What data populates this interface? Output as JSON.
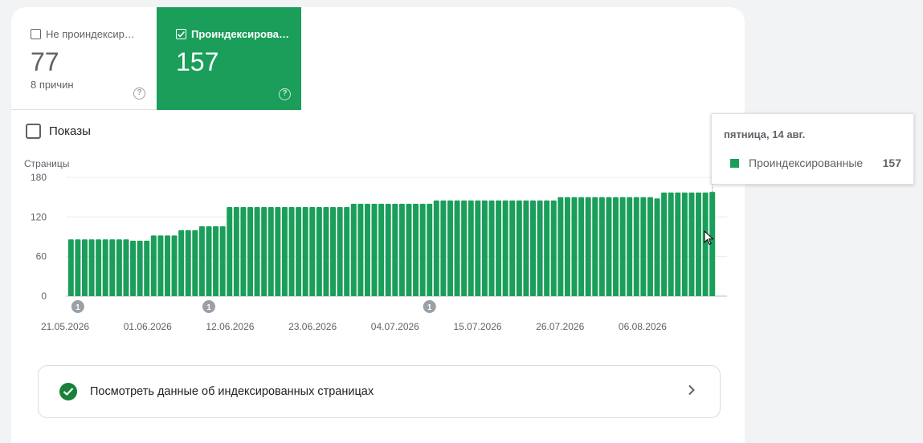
{
  "tabs": {
    "not_indexed": {
      "label": "Не проиндексир…",
      "value": "77",
      "sub": "8 причин"
    },
    "indexed": {
      "label": "Проиндексирова…",
      "value": "157"
    }
  },
  "shows_label": "Показы",
  "colors": {
    "bar": "#1a9e5a",
    "accent": "#188038",
    "grid": "#ececec",
    "axis": "#5f6368"
  },
  "chart_data": {
    "type": "bar",
    "ylabel": "Страницы",
    "ylim": [
      0,
      180
    ],
    "yticks": [
      0,
      60,
      120,
      180
    ],
    "grid": true,
    "xtick_labels": [
      "21.05.2026",
      "01.06.2026",
      "12.06.2026",
      "23.06.2026",
      "04.07.2026",
      "15.07.2026",
      "26.07.2026",
      "06.08.2026"
    ],
    "start_label_index": 0,
    "annotations": [
      {
        "day_index": 1,
        "label": "1"
      },
      {
        "day_index": 20,
        "label": "1"
      },
      {
        "day_index": 52,
        "label": "1"
      }
    ],
    "series": [
      {
        "name": "Проиндексированные",
        "values": [
          86,
          86,
          86,
          86,
          86,
          86,
          86,
          86,
          86,
          84,
          84,
          84,
          92,
          92,
          92,
          92,
          100,
          100,
          100,
          106,
          106,
          106,
          106,
          135,
          135,
          135,
          135,
          135,
          135,
          135,
          135,
          135,
          135,
          135,
          135,
          135,
          135,
          135,
          135,
          135,
          135,
          140,
          140,
          140,
          140,
          140,
          140,
          140,
          140,
          140,
          140,
          140,
          140,
          145,
          145,
          145,
          145,
          145,
          145,
          145,
          145,
          145,
          145,
          145,
          145,
          145,
          145,
          145,
          145,
          145,
          145,
          150,
          150,
          150,
          150,
          150,
          150,
          150,
          150,
          150,
          150,
          150,
          150,
          150,
          150,
          148,
          157,
          157,
          157,
          157,
          157,
          157,
          157,
          158
        ]
      }
    ]
  },
  "link_text": "Посмотреть данные об индексированных страницах",
  "tooltip": {
    "date": "пятница, 14 авг.",
    "series": "Проиндексированные",
    "value": "157"
  }
}
